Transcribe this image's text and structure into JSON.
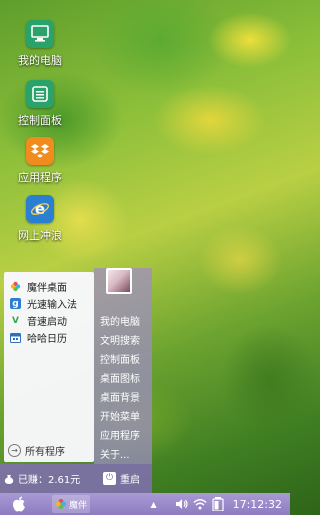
{
  "desktop_icons": [
    {
      "label": "我的电脑",
      "icon": "computer-icon"
    },
    {
      "label": "控制面板",
      "icon": "control-panel-icon"
    },
    {
      "label": "应用程序",
      "icon": "dropbox-icon"
    },
    {
      "label": "网上冲浪",
      "icon": "internet-explorer-icon"
    }
  ],
  "start_menu": {
    "apps": [
      {
        "label": "魔伴桌面",
        "icon": "flower-icon"
      },
      {
        "label": "光速输入法",
        "icon": "input-method-icon"
      },
      {
        "label": "音速启动",
        "icon": "launch-icon"
      },
      {
        "label": "哈哈日历",
        "icon": "calendar-icon"
      }
    ],
    "all_programs": "所有程序",
    "links": [
      "我的电脑",
      "文明搜索",
      "控制面板",
      "桌面图标",
      "桌面背景",
      "开始菜单",
      "应用程序",
      "关于..."
    ],
    "earned": "已赚：2.61元",
    "restart": "重启"
  },
  "taskbar": {
    "app_label": "魔伴",
    "clock": "17:12:32"
  },
  "colors": {
    "menu_right": "#a08cc8",
    "menu_bottom": "#826eb4",
    "taskbar": "#9a8ac8",
    "desktop_icon_green": "#2aa36b",
    "desktop_icon_orange": "#f08c1e",
    "desktop_icon_blue": "#2a7fd0"
  }
}
